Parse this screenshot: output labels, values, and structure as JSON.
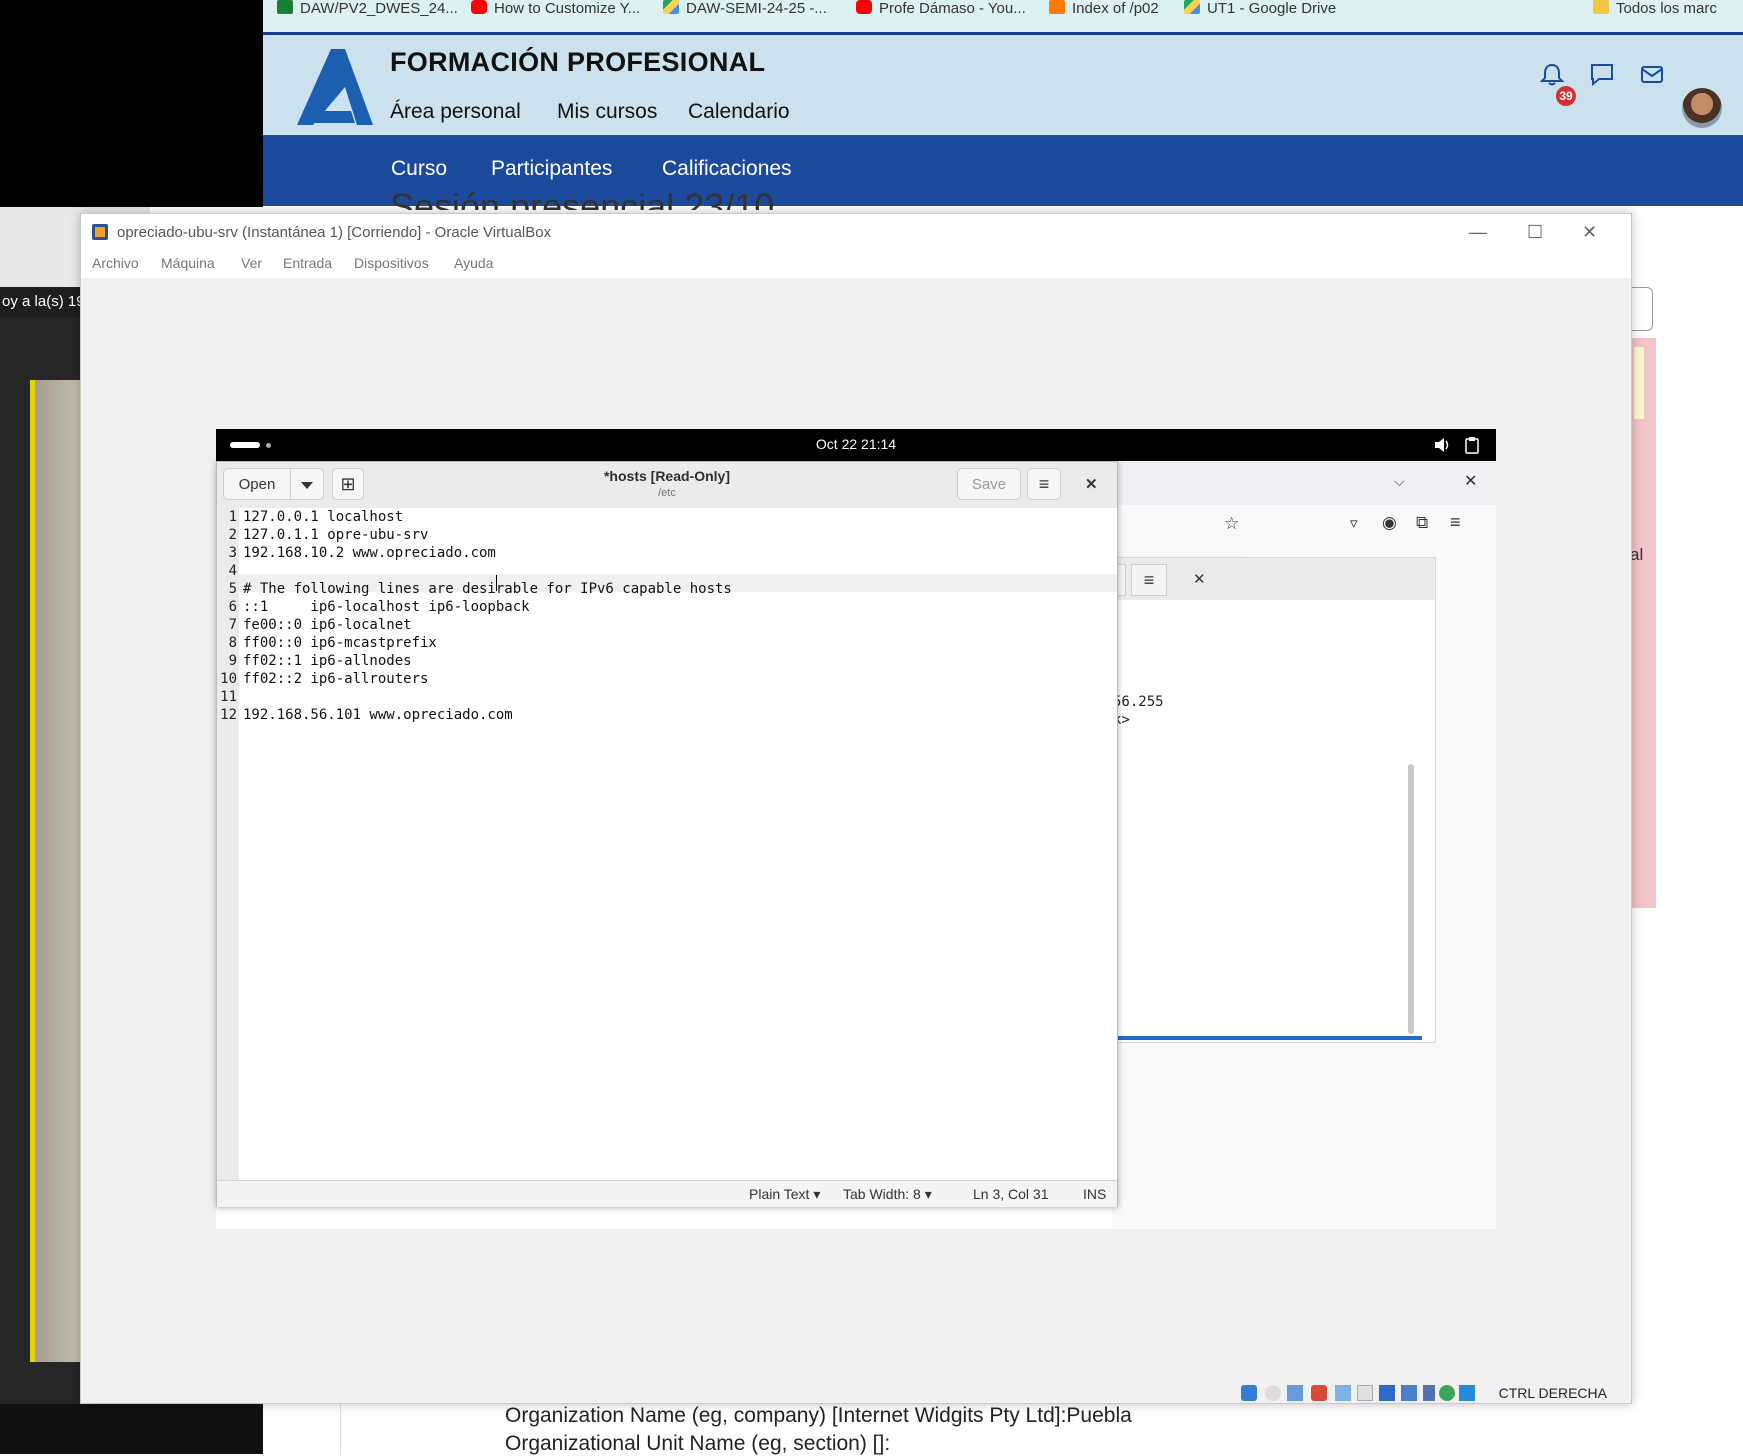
{
  "bookmarks": [
    {
      "label": "DAW/PV2_DWES_24...",
      "color": "#1a7f37"
    },
    {
      "label": "How to Customize Y...",
      "color": "#ff0000"
    },
    {
      "label": "DAW-SEMI-24-25 -...",
      "color": "#1fa463"
    },
    {
      "label": "Profe Dámaso - You...",
      "color": "#ff0000"
    },
    {
      "label": "Index of /p02",
      "color": "#ff7b00"
    },
    {
      "label": "UT1 - Google Drive",
      "color": "#1fa463"
    },
    {
      "label": "Todos los marc",
      "color": "#f4c542"
    }
  ],
  "moodle": {
    "site_title": "FORMACIÓN PROFESIONAL",
    "top_nav": [
      "Área personal",
      "Mis cursos",
      "Calendario"
    ],
    "secondary_nav": [
      "Curso",
      "Participantes",
      "Calificaciones"
    ],
    "notification_count": "39",
    "behind_title": "Sesión presencial 23/10"
  },
  "left_panel": {
    "partial_text": "oy a la(s) 19:"
  },
  "right_panel": {
    "partial_text": "al"
  },
  "bottom_page": {
    "line1": "Organization Name (eg, company) [Internet Widgits Pty Ltd]:Puebla",
    "line2": "Organizational Unit Name (eg, section) []:"
  },
  "vbox": {
    "title": "opreciado-ubu-srv (Instantánea 1) [Corriendo] - Oracle VirtualBox",
    "menu": [
      "Archivo",
      "Máquina",
      "Ver",
      "Entrada",
      "Dispositivos",
      "Ayuda"
    ],
    "status_key": "CTRL DERECHA"
  },
  "guest": {
    "clock": "Oct 22  21:14",
    "terminal_lines": [
      "56.255",
      "k>"
    ],
    "gedit": {
      "open_label": "Open",
      "save_label": "Save",
      "title": "*hosts [Read-Only]",
      "subtitle": "/etc",
      "lines": [
        "127.0.0.1 localhost",
        "127.0.1.1 opre-ubu-srv",
        "192.168.10.2 www.opreciado.com",
        "",
        "# The following lines are desirable for IPv6 capable hosts",
        "::1     ip6-localhost ip6-loopback",
        "fe00::0 ip6-localnet",
        "ff00::0 ip6-mcastprefix",
        "ff02::1 ip6-allnodes",
        "ff02::2 ip6-allrouters",
        "",
        "192.168.56.101 www.opreciado.com"
      ],
      "line_numbers": [
        "1",
        "2",
        "3",
        "4",
        "5",
        "6",
        "7",
        "8",
        "9",
        "10",
        "11",
        "12"
      ],
      "status": {
        "language": "Plain Text",
        "tab_width": "Tab Width: 8",
        "position": "Ln 3, Col 31",
        "mode": "INS"
      }
    }
  },
  "colors": {
    "moodle_nav": "#1c4a9c",
    "moodle_header": "#cbe2ee",
    "bookmark_bar": "#dcf1f1",
    "logo": "#1c5fb0",
    "badge": "#d32f2f"
  }
}
